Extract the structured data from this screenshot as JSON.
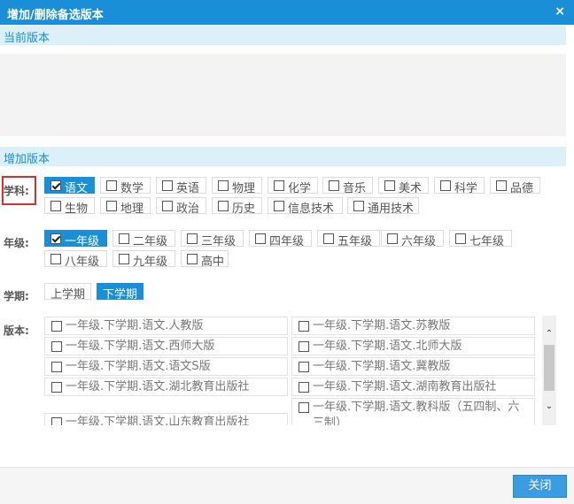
{
  "dialog": {
    "title": "增加/删除备选版本",
    "close_glyph": "×"
  },
  "sections": {
    "current": "当前版本",
    "add": "增加版本"
  },
  "labels": {
    "subject": "学科:",
    "grade": "年级:",
    "term": "学期:",
    "version": "版本:"
  },
  "subjects": [
    "语文",
    "数学",
    "英语",
    "物理",
    "化学",
    "音乐",
    "美术",
    "科学",
    "品德",
    "生物",
    "地理",
    "政治",
    "历史",
    "信息技术",
    "通用技术"
  ],
  "grades": [
    "一年级",
    "二年级",
    "三年级",
    "四年级",
    "五年级",
    "六年级",
    "七年级",
    "八年级",
    "九年级",
    "高中"
  ],
  "terms": [
    "上学期",
    "下学期"
  ],
  "selected": {
    "subject": "语文",
    "grade": "一年级",
    "term": "下学期"
  },
  "versions": [
    "一年级.下学期.语文.人教版",
    "一年级.下学期.语文.苏教版",
    "一年级.下学期.语文.西师大版",
    "一年级.下学期.语文.北师大版",
    "一年级.下学期.语文.语文S版",
    "一年级.下学期.语文.冀教版",
    "一年级.下学期.语文.湖北教育出版社",
    "一年级.下学期.语文.湖南教育出版社",
    "一年级.下学期.语文.山东教育出版社",
    "一年级.下学期.语文.教科版（五四制、六三制）"
  ],
  "footer": {
    "close_label": "关闭"
  },
  "colors": {
    "accent": "#1a8fd8",
    "section_bg": "#dcf0fa",
    "highlight": "#d9302c"
  }
}
